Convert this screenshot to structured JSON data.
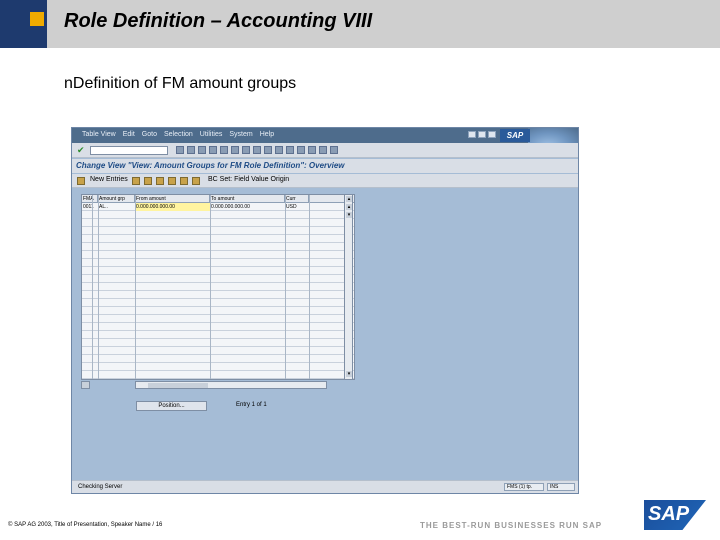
{
  "slide": {
    "title": "Role Definition – Accounting VIII",
    "bullet_marker": "n",
    "bullet_text": "Definition of FM amount groups"
  },
  "window": {
    "menu": [
      "Table View",
      "Edit",
      "Goto",
      "Selection",
      "Utilities",
      "System",
      "Help"
    ],
    "logo": "SAP",
    "command_placeholder": "",
    "screen_title": "Change View \"View: Amount Groups for FM Role Definition\": Overview",
    "app_toolbar": {
      "new_entries": "New Entries",
      "bc_set": "BC Set: Field Value Origin"
    },
    "table": {
      "columns": [
        "FMA",
        "Amount grp",
        "From amount",
        "To amount",
        "Curr"
      ],
      "rows": [
        [
          "0011",
          "AL..",
          "0.000.000.000.00",
          "0.000.000.000.00",
          "USD"
        ]
      ]
    },
    "position_button": "Position...",
    "entry_label": "Entry 1 of 1",
    "status": {
      "message": "Checking Server",
      "system": "FMS (1) tp.",
      "mode": "INS"
    }
  },
  "footer": {
    "copyright": "© SAP AG 2003, Title of Presentation, Speaker Name / 16",
    "tagline": "THE BEST-RUN BUSINESSES RUN SAP",
    "logo": "SAP"
  },
  "colors": {
    "header_bar": "#cfcfcf",
    "header_blue": "#1e3a6e",
    "accent_square": "#f0ab00",
    "gui_background": "#a5bcd6"
  }
}
